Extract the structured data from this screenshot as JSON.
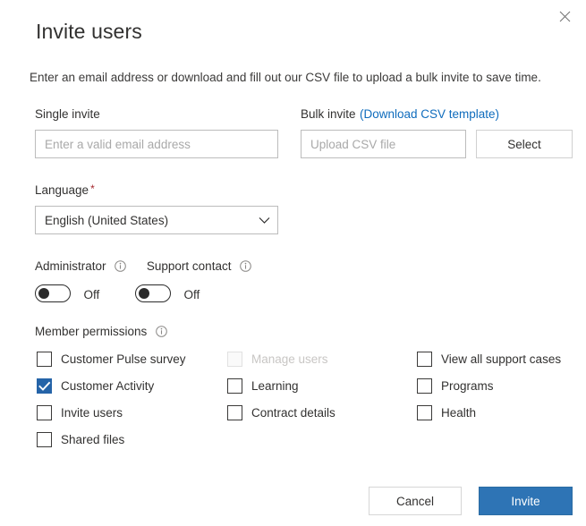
{
  "dialog": {
    "title": "Invite users",
    "description": "Enter an email address or download and fill out our CSV file to upload a bulk invite to save time.",
    "close_icon": "close-icon"
  },
  "single_invite": {
    "label": "Single invite",
    "placeholder": "Enter a valid email address",
    "value": ""
  },
  "bulk_invite": {
    "label": "Bulk invite",
    "link_label": "(Download CSV template)",
    "placeholder": "Upload CSV file",
    "value": "",
    "select_button": "Select"
  },
  "language": {
    "label": "Language",
    "required_marker": "*",
    "selected": "English (United States)",
    "options": [
      "English (United States)"
    ],
    "chevron_icon": "chevron-down-icon"
  },
  "toggles": [
    {
      "label": "Administrator",
      "state": "Off",
      "on": false,
      "info_icon": "info-icon"
    },
    {
      "label": "Support contact",
      "state": "Off",
      "on": false,
      "info_icon": "info-icon"
    }
  ],
  "member_permissions": {
    "label": "Member permissions",
    "info_icon": "info-icon",
    "columns": [
      [
        {
          "label": "Customer Pulse survey",
          "checked": false,
          "disabled": false
        },
        {
          "label": "Customer Activity",
          "checked": true,
          "disabled": false
        },
        {
          "label": "Invite users",
          "checked": false,
          "disabled": false
        },
        {
          "label": "Shared files",
          "checked": false,
          "disabled": false
        }
      ],
      [
        {
          "label": "Manage users",
          "checked": false,
          "disabled": true
        },
        {
          "label": "Learning",
          "checked": false,
          "disabled": false
        },
        {
          "label": "Contract details",
          "checked": false,
          "disabled": false
        }
      ],
      [
        {
          "label": "View all support cases",
          "checked": false,
          "disabled": false
        },
        {
          "label": "Programs",
          "checked": false,
          "disabled": false
        },
        {
          "label": "Health",
          "checked": false,
          "disabled": false
        }
      ]
    ]
  },
  "footer": {
    "cancel_label": "Cancel",
    "invite_label": "Invite"
  },
  "colors": {
    "primary": "#2e74b5",
    "link": "#0f6cbd",
    "required": "#a4262c",
    "checkbox_checked": "#2564a8",
    "text": "#323130",
    "disabled_text": "#c8c6c4"
  }
}
